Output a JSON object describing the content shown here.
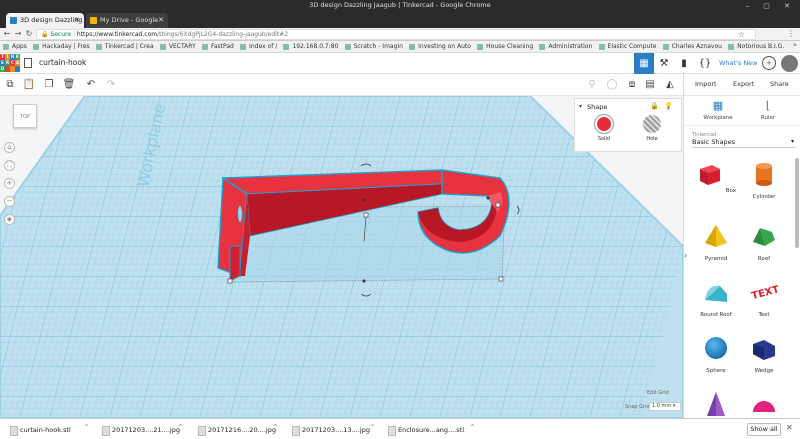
{
  "window": {
    "title": "3D design Dazzling Jaagub | Tinkercad - Google Chrome"
  },
  "tabs": [
    {
      "label": "3D design Dazzling",
      "active": true
    },
    {
      "label": "My Drive - Google",
      "active": false
    }
  ],
  "omnibar": {
    "secure_label": "Secure",
    "url_host": "https://www.tinkercad.com",
    "url_path": "/things/6XdgPjL2G4-dazzling-jaagub/edit#2"
  },
  "bookmarks": [
    "Apps",
    "Hackaday | Fres",
    "Tinkercad | Crea",
    "VECTARY",
    "FastPad",
    "Index of /",
    "192.168.0.7:80",
    "Scratch - Imagin",
    "Investing on Auto",
    "House Cleaning",
    "Administration",
    "Elastic Compute",
    "Charles Aznavou",
    "Notorious B.I.G."
  ],
  "tinkercad": {
    "design_name": "curtain-hook",
    "whats_new": "What's New",
    "panel_tabs": {
      "import": "Import",
      "export": "Export",
      "share": "Share"
    },
    "workplane_label": "Workplane",
    "ruler_label": "Ruler",
    "library_provider": "Tinkercad",
    "library_name": "Basic Shapes",
    "shapes": [
      {
        "name": "Box",
        "color": "#d71f2f"
      },
      {
        "name": "Cylinder",
        "color": "#e97520"
      },
      {
        "name": "Pyramid",
        "color": "#f3c31d"
      },
      {
        "name": "Roof",
        "color": "#3aa54d"
      },
      {
        "name": "Round Roof",
        "color": "#3bb3c9"
      },
      {
        "name": "Text",
        "color": "#d71f2f"
      },
      {
        "name": "Sphere",
        "color": "#1b8ad4"
      },
      {
        "name": "Wedge",
        "color": "#263a8e"
      }
    ],
    "shape_panel": {
      "title": "Shape",
      "solid_label": "Solid",
      "hole_label": "Hole",
      "solid_color": "#e52b3a"
    },
    "workplane_text": "Workplane",
    "viewcube_label": "TOP",
    "edit_grid": "Edit Grid",
    "snap_grid_label": "Snap Grid",
    "snap_grid_value": "1.0 mm"
  },
  "downloads": [
    "curtain-hook.stl",
    "20171203....21....jpg",
    "20171216....20....jpg",
    "20171203....13....jpg",
    "Enclosure...ang....stl"
  ],
  "downloads_show_all": "Show all",
  "colors": {
    "accent": "#2a7ec3",
    "grid_bg": "#b9dceb",
    "grid_line": "#8dc6de",
    "object_red": "#e5303f",
    "selection": "#1aa3d0"
  }
}
